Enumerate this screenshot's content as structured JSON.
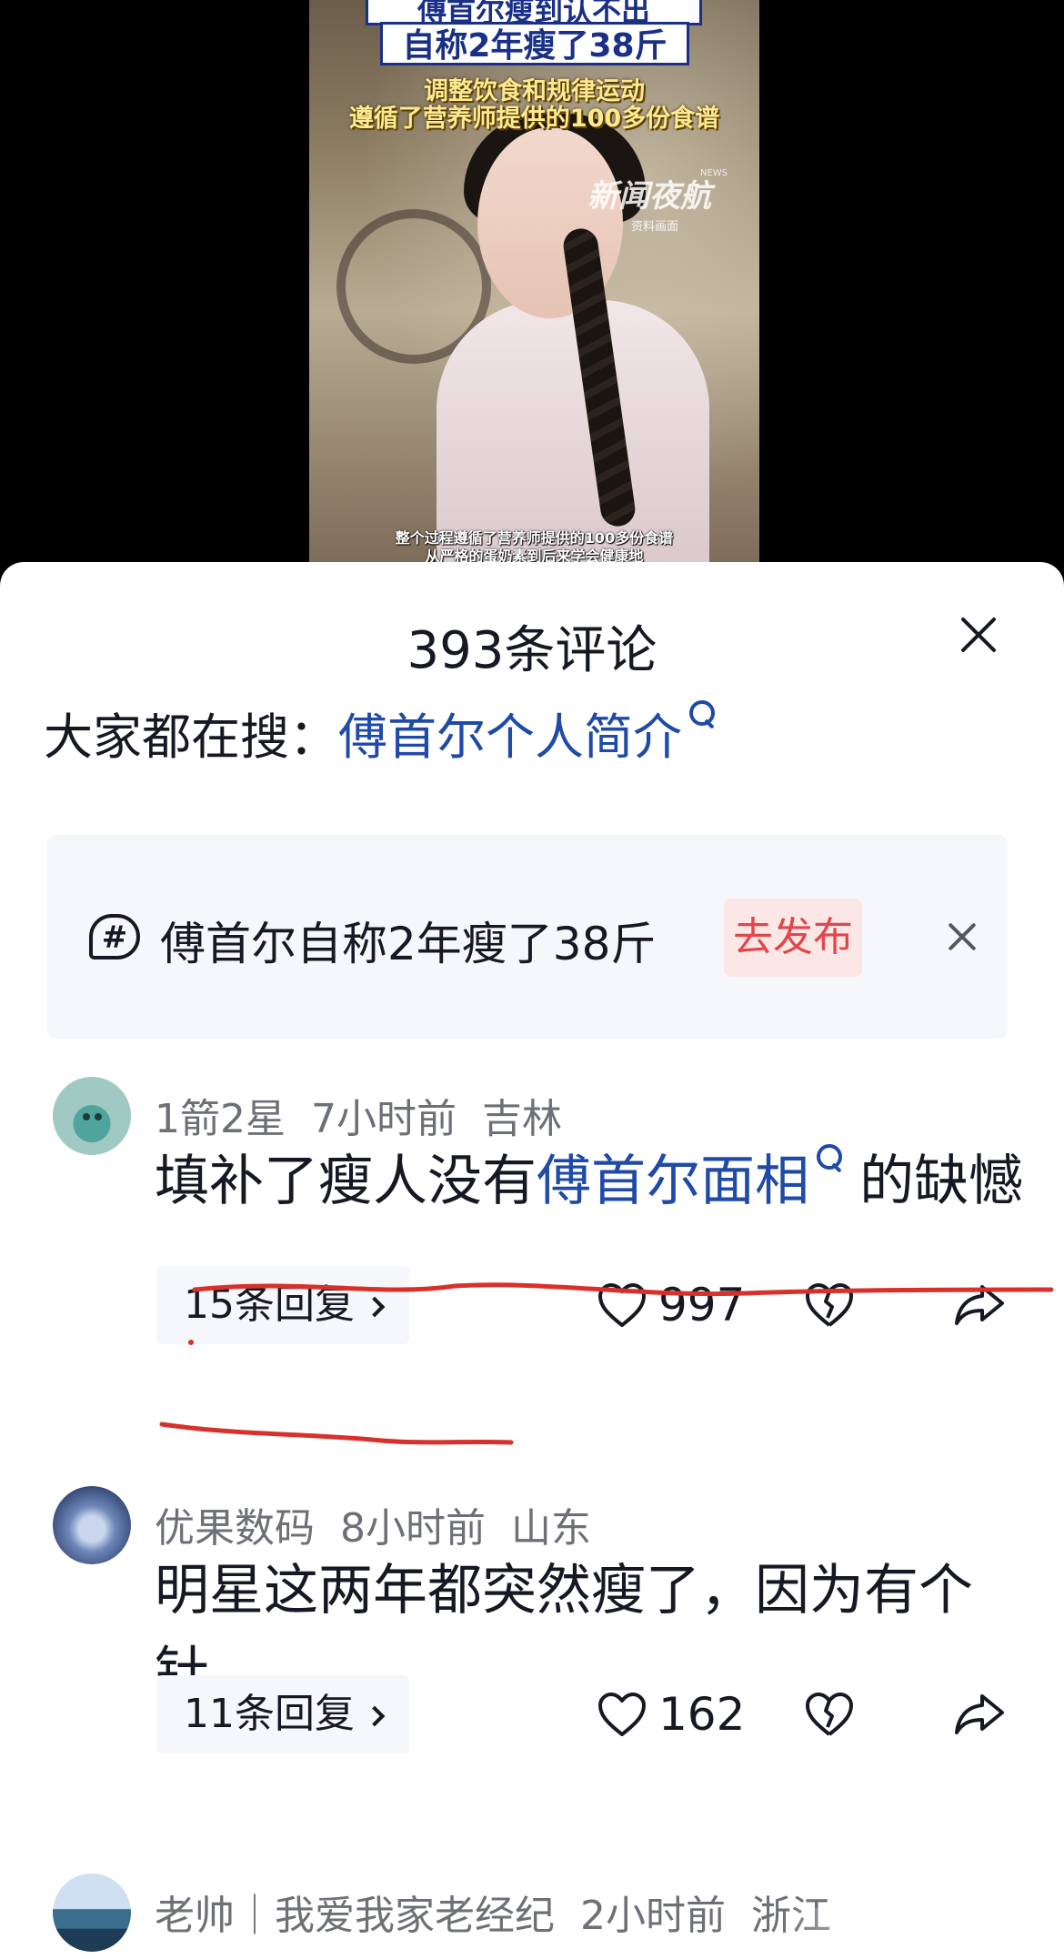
{
  "video": {
    "headline_top": "傅首尔瘦到认不出",
    "headline_main": "自称2年瘦了38斤",
    "subtitle_1": "调整饮食和规律运动",
    "subtitle_2": "遵循了营养师提供的100多份食谱",
    "logo": "新闻夜航",
    "logo_news": "NEWS",
    "logo_note": "资料画面",
    "caption_1": "整个过程遵循了营养师提供的100多份食谱",
    "caption_2": "从严格的蛋奶素到后来学会健康地"
  },
  "sheet": {
    "title": "393条评论",
    "search_prefix": "大家都在搜：",
    "search_term": "傅首尔个人简介",
    "topic": {
      "text": "傅首尔自称2年瘦了38斤",
      "publish_label": "去发布"
    }
  },
  "comments": [
    {
      "author": "1箭2星",
      "time": "7小时前",
      "location": "吉林",
      "text_before": "填补了瘦人没有",
      "text_link": "傅首尔面相",
      "text_after": "的缺憾",
      "replies": "15条回复",
      "likes": "997"
    },
    {
      "author": "优果数码",
      "time": "8小时前",
      "location": "山东",
      "text": "明星这两年都突然瘦了，因为有个针",
      "replies": "11条回复",
      "likes": "162"
    },
    {
      "author": "老帅｜我爱我家老经纪",
      "time": "2小时前",
      "location": "浙江"
    }
  ],
  "colors": {
    "link": "#1f4aa8",
    "publish_bg": "#fbe8e6",
    "publish_text": "#e3454b",
    "annotation_red": "#d8312b"
  }
}
